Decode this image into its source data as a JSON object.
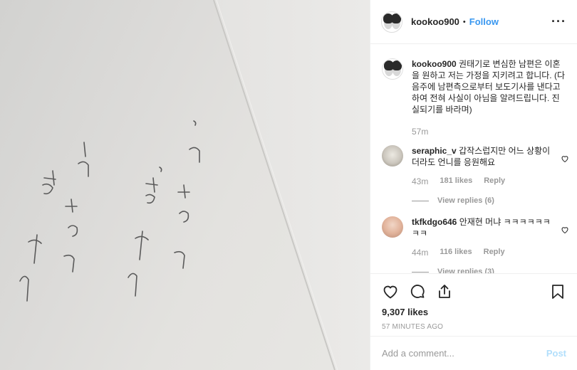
{
  "post": {
    "username": "kookoo900",
    "follow_label": "Follow",
    "more_icon": "more-horizontal-icon"
  },
  "caption": {
    "username": "kookoo900",
    "text": "권태기로 변심한 남편은 이혼을 원하고 저는 가정을 지키려고 합니다. (다음주에 남편측으로부터 보도기사를 낸다고 하여 전혀 사실이 아님을 알려드립니다. 진실되기를 바라며)",
    "time": "57m"
  },
  "comments": [
    {
      "username": "seraphic_v",
      "text": "갑작스럽지만 어느 상황이더라도 언니를 응원해요",
      "time": "43m",
      "likes": "181 likes",
      "reply": "Reply",
      "view_replies": "View replies (6)"
    },
    {
      "username": "tkfkdgo646",
      "text": "안재현 머냐 ㅋㅋㅋㅋㅋㅋㅋㅋ",
      "time": "44m",
      "likes": "116 likes",
      "reply": "Reply",
      "view_replies": "View replies (3)"
    }
  ],
  "actions": {
    "likes_total": "9,307 likes",
    "posted_ago": "57 MINUTES AGO"
  },
  "add_comment": {
    "placeholder": "Add a comment...",
    "post_label": "Post"
  },
  "photo": {
    "handwriting_left": "사랑해 그리고 고마워",
    "handwriting_right": "사랑해. 그리고 고마워."
  },
  "colors": {
    "accent": "#3897f0",
    "post_disabled": "#b2dffc",
    "muted": "#999999",
    "border": "#efefef"
  }
}
